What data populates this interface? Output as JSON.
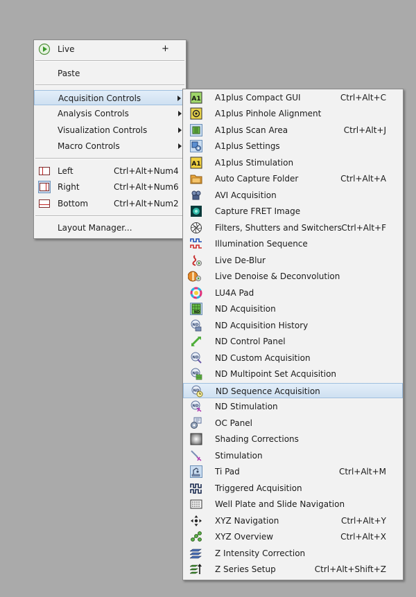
{
  "main_menu": {
    "live": {
      "label": "Live",
      "expand": "+"
    },
    "paste": {
      "label": "Paste"
    },
    "acquisition_controls": {
      "label": "Acquisition Controls"
    },
    "analysis_controls": {
      "label": "Analysis Controls"
    },
    "visualization_controls": {
      "label": "Visualization Controls"
    },
    "macro_controls": {
      "label": "Macro Controls"
    },
    "left": {
      "label": "Left",
      "shortcut": "Ctrl+Alt+Num4"
    },
    "right": {
      "label": "Right",
      "shortcut": "Ctrl+Alt+Num6"
    },
    "bottom": {
      "label": "Bottom",
      "shortcut": "Ctrl+Alt+Num2"
    },
    "layout_manager": {
      "label": "Layout Manager..."
    }
  },
  "sub_menu": {
    "items": [
      {
        "label": "A1plus Compact GUI",
        "shortcut": "Ctrl+Alt+C",
        "icon": "a1-icon"
      },
      {
        "label": "A1plus Pinhole Alignment",
        "shortcut": "",
        "icon": "pinhole-icon"
      },
      {
        "label": "A1plus Scan Area",
        "shortcut": "Ctrl+Alt+J",
        "icon": "scan-area-icon"
      },
      {
        "label": "A1plus Settings",
        "shortcut": "",
        "icon": "settings-icon"
      },
      {
        "label": "A1plus Stimulation",
        "shortcut": "",
        "icon": "a1-icon"
      },
      {
        "label": "Auto Capture Folder",
        "shortcut": "Ctrl+Alt+A",
        "icon": "folder-icon"
      },
      {
        "label": "AVI Acquisition",
        "shortcut": "",
        "icon": "film-icon"
      },
      {
        "label": "Capture FRET Image",
        "shortcut": "",
        "icon": "fret-icon"
      },
      {
        "label": "Filters, Shutters and Switchers",
        "shortcut": "Ctrl+Alt+F",
        "icon": "shutter-icon"
      },
      {
        "label": "Illumination Sequence",
        "shortcut": "",
        "icon": "pulse-icon"
      },
      {
        "label": "Live De-Blur",
        "shortcut": "",
        "icon": "deblur-icon"
      },
      {
        "label": "Live Denoise & Deconvolution",
        "shortcut": "",
        "icon": "denoise-icon"
      },
      {
        "label": "LU4A Pad",
        "shortcut": "",
        "icon": "color-wheel-icon"
      },
      {
        "label": "ND Acquisition",
        "shortcut": "",
        "icon": "nd-grid-icon"
      },
      {
        "label": "ND Acquisition History",
        "shortcut": "",
        "icon": "nd-history-icon"
      },
      {
        "label": "ND Control Panel",
        "shortcut": "",
        "icon": "nd-control-icon"
      },
      {
        "label": "ND Custom Acquisition",
        "shortcut": "",
        "icon": "nd-custom-icon"
      },
      {
        "label": "ND Multipoint Set Acquisition",
        "shortcut": "",
        "icon": "nd-multipoint-icon"
      },
      {
        "label": "ND Sequence Acquisition",
        "shortcut": "",
        "icon": "nd-sequence-icon"
      },
      {
        "label": "ND Stimulation",
        "shortcut": "",
        "icon": "nd-stimulation-icon"
      },
      {
        "label": "OC Panel",
        "shortcut": "",
        "icon": "oc-panel-icon"
      },
      {
        "label": "Shading Corrections",
        "shortcut": "",
        "icon": "shading-icon"
      },
      {
        "label": "Stimulation",
        "shortcut": "",
        "icon": "stimulation-icon"
      },
      {
        "label": "Ti Pad",
        "shortcut": "Ctrl+Alt+M",
        "icon": "ti-pad-icon"
      },
      {
        "label": "Triggered Acquisition",
        "shortcut": "",
        "icon": "trigger-icon"
      },
      {
        "label": "Well Plate and Slide Navigation",
        "shortcut": "",
        "icon": "well-plate-icon"
      },
      {
        "label": "XYZ Navigation",
        "shortcut": "Ctrl+Alt+Y",
        "icon": "xyz-nav-icon"
      },
      {
        "label": "XYZ Overview",
        "shortcut": "Ctrl+Alt+X",
        "icon": "xyz-overview-icon"
      },
      {
        "label": "Z Intensity Correction",
        "shortcut": "",
        "icon": "z-intensity-icon"
      },
      {
        "label": "Z Series Setup",
        "shortcut": "Ctrl+Alt+Shift+Z",
        "icon": "z-series-icon"
      }
    ]
  },
  "icon_labels": {
    "a1": "A1",
    "nd": "ND"
  }
}
